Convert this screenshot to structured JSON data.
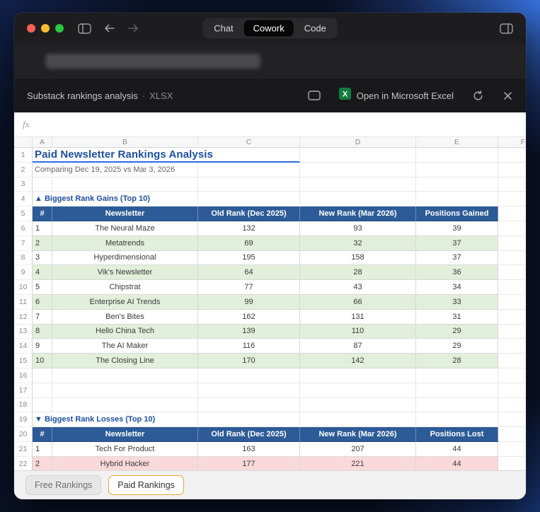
{
  "window_chrome": {
    "traffic_lights": [
      "close",
      "minimize",
      "zoom"
    ],
    "nav_tabs": [
      {
        "label": "Chat",
        "active": false
      },
      {
        "label": "Cowork",
        "active": true
      },
      {
        "label": "Code",
        "active": false
      }
    ]
  },
  "doc_header": {
    "title": "Substack rankings analysis",
    "separator": "·",
    "file_type": "XLSX",
    "open_excel_label": "Open in Microsoft Excel"
  },
  "formula_bar": {
    "fx_label": "fx"
  },
  "spreadsheet": {
    "column_letters": [
      "A",
      "B",
      "C",
      "D",
      "E",
      "F"
    ],
    "row_count": 22,
    "title": "Paid Newsletter Rankings Analysis",
    "subtitle": "Comparing Dec 19, 2025 vs Mar 3, 2026",
    "gains_section": {
      "heading": "▲ Biggest Rank Gains (Top 10)",
      "headers": [
        "#",
        "Newsletter",
        "Old Rank (Dec 2025)",
        "New Rank (Mar 2026)",
        "Positions Gained"
      ],
      "rows": [
        [
          1,
          "The Neural Maze",
          132,
          93,
          39
        ],
        [
          2,
          "Metatrends",
          69,
          32,
          37
        ],
        [
          3,
          "Hyperdimensional",
          195,
          158,
          37
        ],
        [
          4,
          "Vik's Newsletter",
          64,
          28,
          36
        ],
        [
          5,
          "Chipstrat",
          77,
          43,
          34
        ],
        [
          6,
          "Enterprise AI Trends",
          99,
          66,
          33
        ],
        [
          7,
          "Ben's Bites",
          162,
          131,
          31
        ],
        [
          8,
          "Hello China Tech",
          139,
          110,
          29
        ],
        [
          9,
          "The AI Maker",
          116,
          87,
          29
        ],
        [
          10,
          "The Closing Line",
          170,
          142,
          28
        ]
      ]
    },
    "losses_section": {
      "heading": "▼ Biggest Rank Losses (Top 10)",
      "headers": [
        "#",
        "Newsletter",
        "Old Rank (Dec 2025)",
        "New Rank (Mar 2026)",
        "Positions Lost"
      ],
      "rows": [
        [
          1,
          "Tech For Product",
          163,
          207,
          44
        ],
        [
          2,
          "Hybrid Hacker",
          177,
          221,
          44
        ]
      ]
    },
    "sheet_tabs": [
      {
        "label": "Free Rankings",
        "active": false
      },
      {
        "label": "Paid Rankings",
        "active": true
      }
    ]
  },
  "colors": {
    "table_header_blue": "#2d5b97",
    "title_blue": "#1d4f9e",
    "gain_row_green": "#e2efda",
    "loss_row_pink": "#f9d9d9",
    "active_sheet_tab_border": "#e5a43b",
    "excel_green": "#107c41",
    "selection_border_blue": "#2f6be0"
  }
}
